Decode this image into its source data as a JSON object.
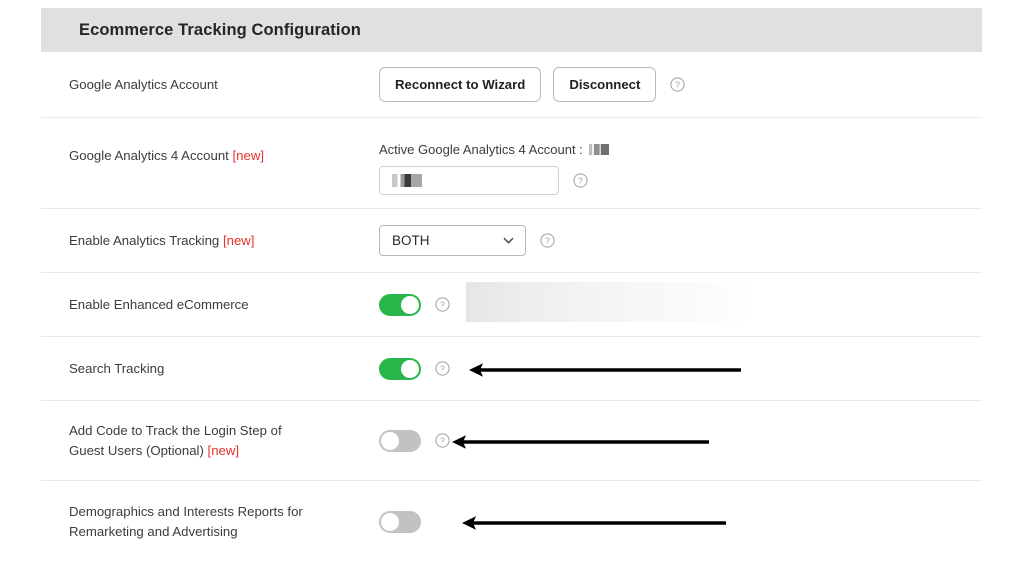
{
  "panel": {
    "header_title": "Ecommerce Tracking Configuration"
  },
  "icons": {
    "help": "help-circle-icon",
    "chevron": "chevron-down-icon",
    "arrow": "left-arrow-annotation"
  },
  "colors": {
    "header_bg": "#e0e0e0",
    "toggle_on": "#2ab54b",
    "toggle_off": "#c2c2c2",
    "new_tag": "#e8312a",
    "row_divider": "#eaeaea",
    "text": "#3c3c3c"
  },
  "rows": {
    "ga_account": {
      "label": "Google Analytics Account",
      "reconnect_button": "Reconnect to Wizard",
      "disconnect_button": "Disconnect"
    },
    "ga4_account": {
      "label": "Google Analytics 4 Account",
      "new_tag": "[new]",
      "active_account_text": "Active Google Analytics 4 Account :",
      "active_account_value": "",
      "input_value": "",
      "input_placeholder": ""
    },
    "analytics_tracking": {
      "label": "Enable Analytics Tracking",
      "new_tag": "[new]",
      "selected_option": "BOTH",
      "options": [
        "BOTH"
      ]
    },
    "enhanced_ecommerce": {
      "label": "Enable Enhanced eCommerce",
      "toggle_state": "on"
    },
    "search_tracking": {
      "label": "Search Tracking",
      "toggle_state": "on"
    },
    "login_step": {
      "label_line1": "Add Code to Track the Login Step of",
      "label_line2": "Guest Users (Optional)",
      "new_tag": "[new]",
      "toggle_state": "off"
    },
    "demographics": {
      "label_line1": "Demographics and Interests Reports for",
      "label_line2": "Remarketing and Advertising",
      "toggle_state": "off"
    }
  }
}
